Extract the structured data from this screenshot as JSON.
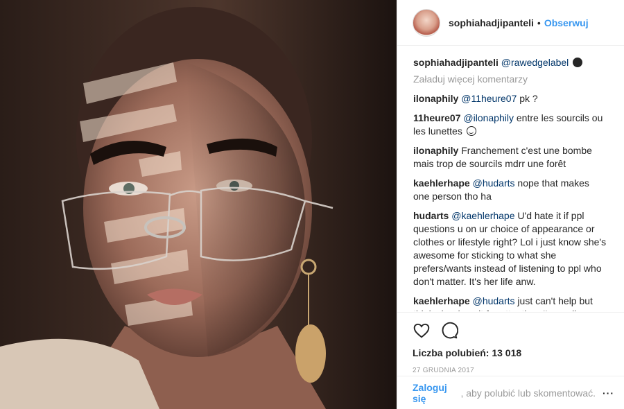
{
  "post": {
    "author": "sophiahadjipanteli",
    "follow_label": "Obserwuj",
    "separator": "•",
    "caption": {
      "user": "sophiahadjipanteli",
      "mention": "@rawedgelabel",
      "emoji": "alien-monster-emoji"
    },
    "load_more": "Załaduj więcej komentarzy",
    "comments": [
      {
        "user": "ilonaphily",
        "mention": "@11heure07",
        "text": " pk ?"
      },
      {
        "user": "11heure07",
        "mention": "@ilonaphily",
        "text": " entre les sourcils ou les lunettes",
        "emoji": "smile-emoji"
      },
      {
        "user": "ilonaphily",
        "mention": "",
        "text": "Franchement c'est une bombe mais trop de sourcils mdrr une forêt"
      },
      {
        "user": "kaehlerhape",
        "mention": "@hudarts",
        "text": " nope that makes one person tho ha"
      },
      {
        "user": "hudarts",
        "mention": "@kaehlerhape",
        "text": " U'd hate it if ppl questions u on ur choice of appearance or clothes or lifestyle right? Lol i just know she's awesome for sticking to what she prefers/wants instead of listening to ppl who don't matter. It's her life anw."
      },
      {
        "user": "kaehlerhape",
        "mention": "@hudarts",
        "text": " just can't help but think she does it for attention. I'm prolly wrong but that's what it seems like from"
      }
    ],
    "likes_label": "Liczba polubień: 13 018",
    "date": "27 GRUDNIA 2017",
    "login_link": "Zaloguj się",
    "login_rest": ", aby polubić lub skomentować.",
    "more_label": "···"
  },
  "photo": {
    "description_icon": "portrait-photo",
    "colors": {
      "skin": "#c89a86",
      "shadow": "#5a3a30",
      "light": "#f4e2d2"
    }
  },
  "icons": [
    "heart-icon",
    "comment-icon",
    "more-options-icon"
  ],
  "colors": {
    "accent": "#3897f0",
    "mention": "#003569",
    "muted": "#999999",
    "border": "#efefef"
  }
}
